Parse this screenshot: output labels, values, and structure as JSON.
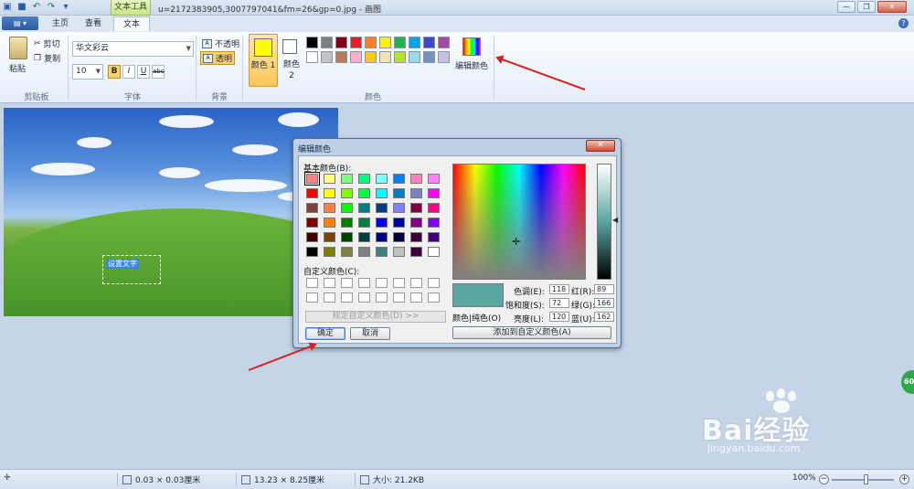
{
  "window": {
    "title": "u=2172383905,3007797041&fm=26&gp=0.jpg - 画图",
    "context_tab": "文本工具",
    "buttons": [
      "—",
      "❐",
      "✕"
    ]
  },
  "tabs": {
    "file_label": "▤ ▾",
    "items": [
      {
        "label": "主页"
      },
      {
        "label": "查看"
      },
      {
        "label": "文本"
      }
    ]
  },
  "ribbon": {
    "clipboard": {
      "paste": "粘贴",
      "cut": "剪切",
      "copy": "复制",
      "group": "剪贴板"
    },
    "font": {
      "family": "华文彩云",
      "size": "10",
      "bold": "B",
      "italic": "I",
      "underline": "U",
      "strike": "abc",
      "group": "字体"
    },
    "background": {
      "opaque": "不透明",
      "transparent": "透明",
      "group": "背景"
    },
    "colors": {
      "color1_label": "颜色 1",
      "color2_label": "颜色 2",
      "edit_label": "编辑颜色",
      "group": "颜色",
      "color1": "#ffff00",
      "color2": "#ffffff",
      "palette": [
        "#000000",
        "#7f7f7f",
        "#880015",
        "#ed1c24",
        "#ff7f27",
        "#fff200",
        "#22b14c",
        "#00a2e8",
        "#3f48cc",
        "#a349a4",
        "#ffffff",
        "#c3c3c3",
        "#b97a57",
        "#ffaec9",
        "#ffc90e",
        "#efe4b0",
        "#b5e61d",
        "#99d9ea",
        "#7092be",
        "#c8bfe7"
      ]
    }
  },
  "canvas": {
    "text_box": "设置文字"
  },
  "dialog": {
    "title": "编辑颜色",
    "close": "✕",
    "basic_label": "基本颜色(B):",
    "custom_label": "自定义颜色(C):",
    "define_button": "规定自定义颜色(D) >>",
    "ok": "确定",
    "cancel": "取消",
    "color_solid_label": "颜色|纯色(O)",
    "hue_label": "色调(E):",
    "hue": "118",
    "sat_label": "饱和度(S):",
    "sat": "72",
    "lum_label": "亮度(L):",
    "lum": "120",
    "red_label": "红(R):",
    "red": "89",
    "green_label": "绿(G):",
    "green": "166",
    "blue_label": "蓝(U):",
    "blue": "162",
    "add_custom": "添加到自定义颜色(A)",
    "preview_color": "#59a6a2",
    "basic_colors": [
      "#ff8080",
      "#ffff80",
      "#80ff80",
      "#00ff80",
      "#80ffff",
      "#0080ff",
      "#ff80c0",
      "#ff80ff",
      "#ff0000",
      "#ffff00",
      "#80ff00",
      "#00ff40",
      "#00ffff",
      "#0080c0",
      "#8080c0",
      "#ff00ff",
      "#804040",
      "#ff8040",
      "#00ff00",
      "#008080",
      "#004080",
      "#8080ff",
      "#800040",
      "#ff0080",
      "#800000",
      "#ff8000",
      "#008000",
      "#008040",
      "#0000ff",
      "#0000a0",
      "#800080",
      "#8000ff",
      "#400000",
      "#804000",
      "#004000",
      "#004040",
      "#000080",
      "#000040",
      "#400040",
      "#400080",
      "#000000",
      "#808000",
      "#808040",
      "#808080",
      "#408080",
      "#c0c0c0",
      "#400040",
      "#ffffff"
    ]
  },
  "status": {
    "pos": "0.03 × 0.03厘米",
    "size": "13.23 × 8.25厘米",
    "file": "大小: 21.2KB",
    "zoom": "100%"
  },
  "watermark": {
    "text": "Bai经验",
    "url": "jingyan.baidu.com",
    "badge": "60"
  }
}
